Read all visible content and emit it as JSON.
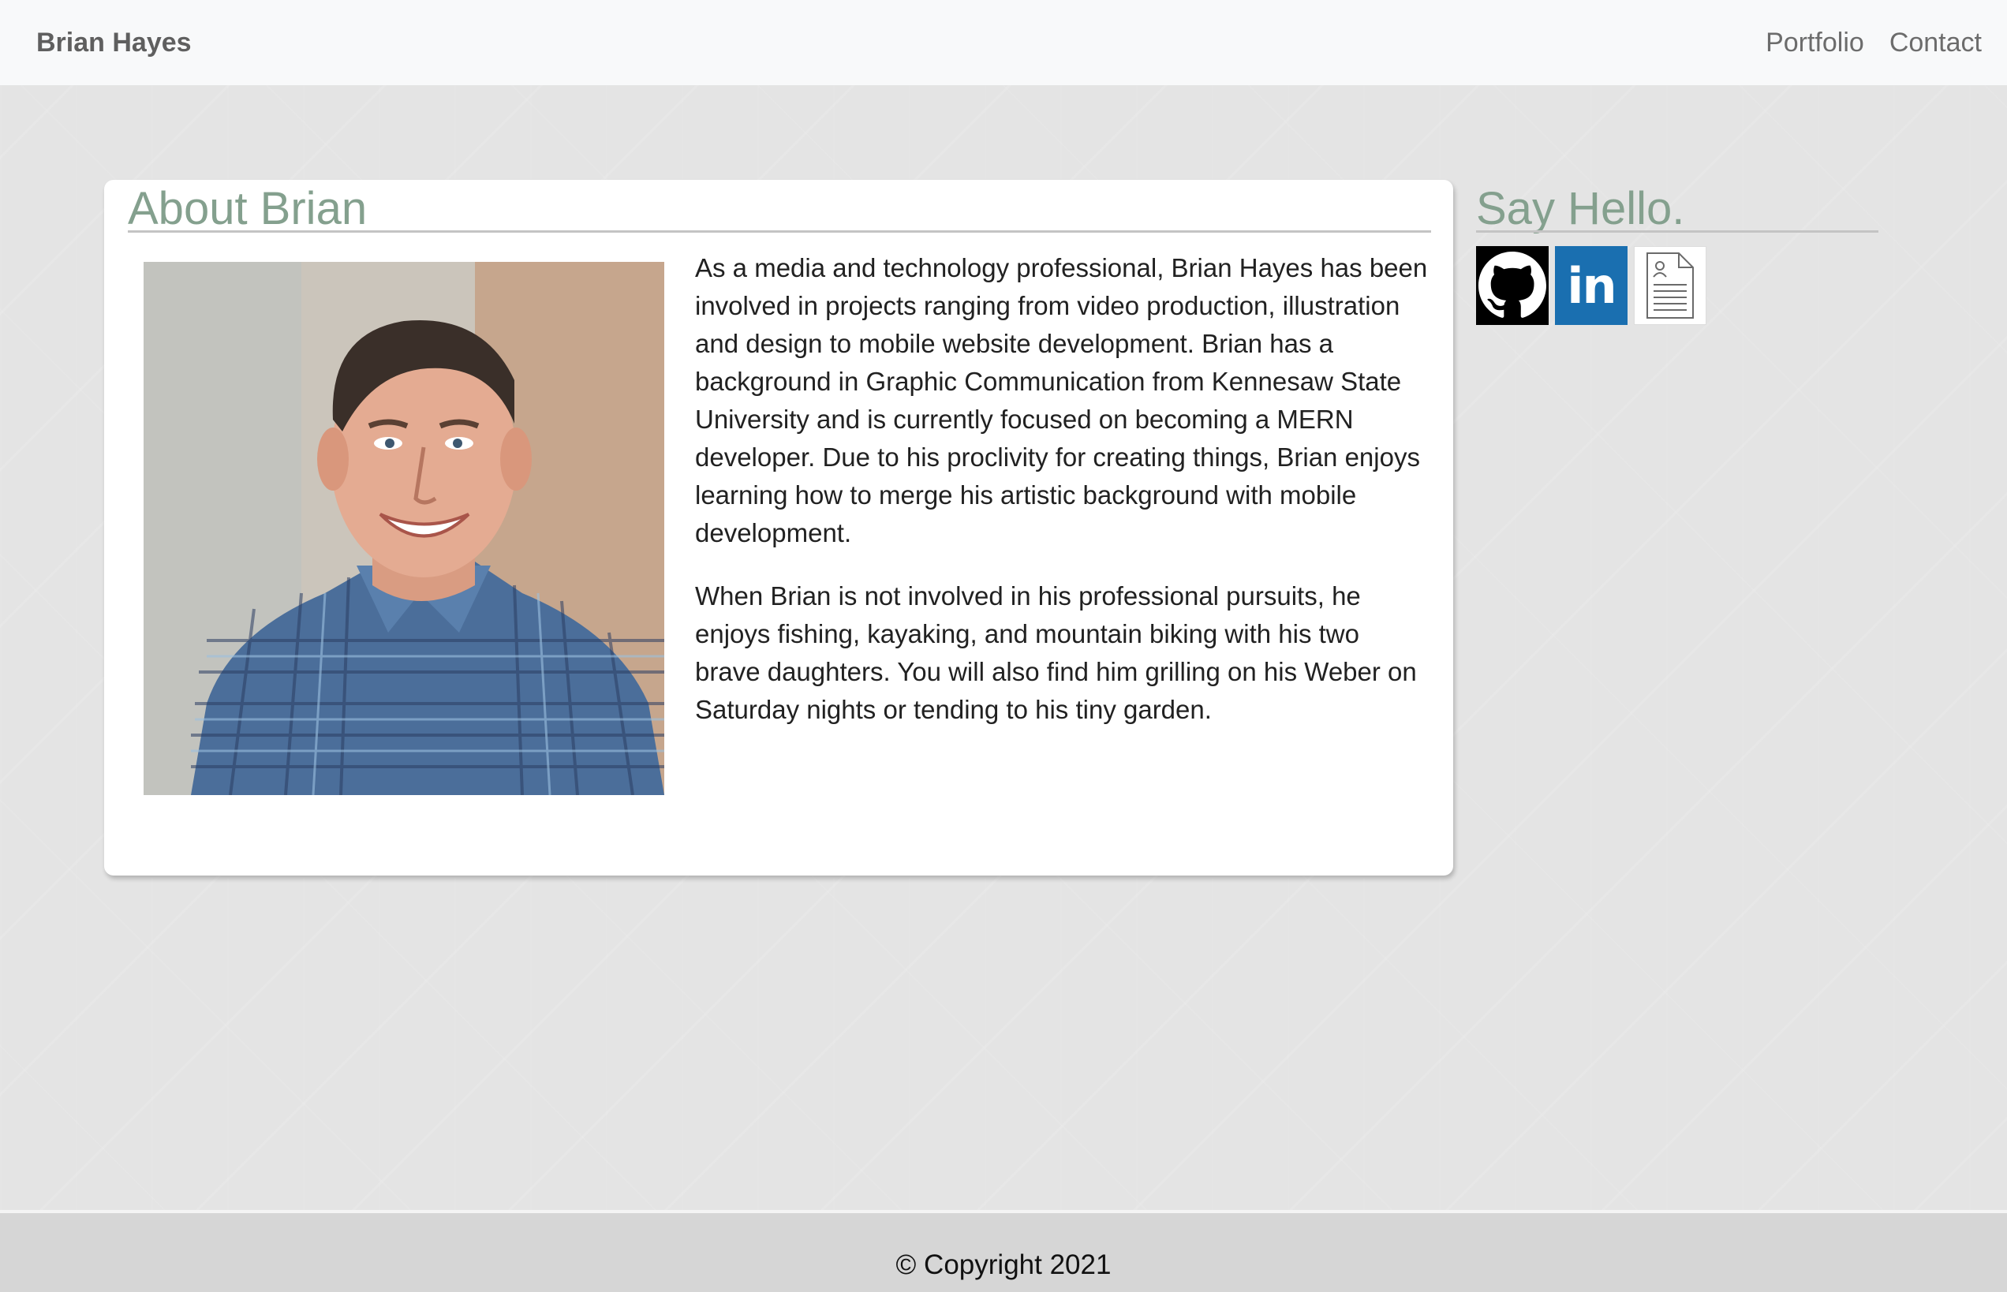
{
  "navbar": {
    "brand": "Brian Hayes",
    "links": [
      "Portfolio",
      "Contact"
    ]
  },
  "about": {
    "title": "About Brian",
    "paragraphs": [
      "As a media and technology professional, Brian Hayes has been involved in projects ranging from video production, illustration and design to mobile website development. Brian has a background in Graphic Communication from Kennesaw State University and is currently focused on becoming a MERN developer. Due to his proclivity for creating things, Brian enjoys learning how to merge his artistic background with mobile development.",
      "When Brian is not involved in his professional pursuits, he enjoys fishing, kayaking, and mountain biking with his two brave daughters. You will also find him grilling on his Weber on Saturday nights or tending to his tiny garden."
    ]
  },
  "contact": {
    "title": "Say Hello.",
    "icons": {
      "github": "github-icon",
      "linkedin": "linkedin-icon",
      "linkedin_text": "in",
      "resume": "resume-document-icon"
    }
  },
  "footer": {
    "copyright": "© Copyright 2021"
  },
  "colors": {
    "heading": "#84a08e",
    "navbar_bg": "#f8f9fa",
    "linkedin_blue": "#1a6fb0",
    "footer_bg": "#d6d6d6"
  }
}
